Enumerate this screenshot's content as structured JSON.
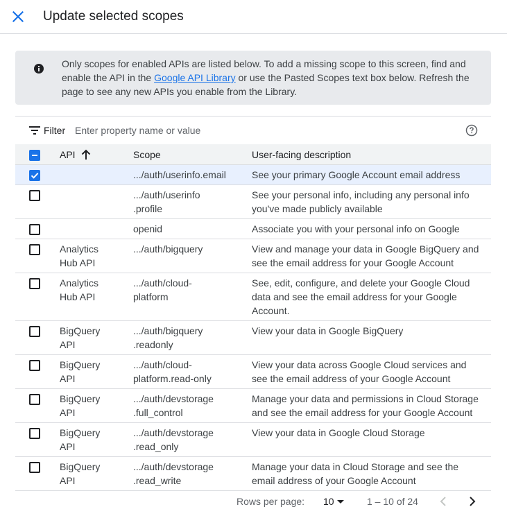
{
  "dialog": {
    "title": "Update selected scopes"
  },
  "info": {
    "text_before": "Only scopes for enabled APIs are listed below. To add a missing scope to this screen, find and enable the API in the ",
    "link": "Google API Library",
    "text_after": " or use the Pasted Scopes text box below. Refresh the page to see any new APIs you enable from the Library."
  },
  "filter": {
    "label": "Filter",
    "placeholder": "Enter property name or value"
  },
  "table": {
    "headers": {
      "api": "API",
      "scope": "Scope",
      "desc": "User-facing description"
    },
    "rows": [
      {
        "checked": true,
        "api_l1": "",
        "api_l2": "",
        "scope_l1": ".../auth/userinfo.email",
        "scope_l2": "",
        "desc_l1": "See your primary Google Account email address",
        "desc_l2": "",
        "desc_l3": ""
      },
      {
        "checked": false,
        "api_l1": "",
        "api_l2": "",
        "scope_l1": ".../auth/userinfo",
        "scope_l2": ".profile",
        "desc_l1": "See your personal info, including any personal info",
        "desc_l2": "you've made publicly available",
        "desc_l3": ""
      },
      {
        "checked": false,
        "api_l1": "",
        "api_l2": "",
        "scope_l1": "openid",
        "scope_l2": "",
        "desc_l1": "Associate you with your personal info on Google",
        "desc_l2": "",
        "desc_l3": ""
      },
      {
        "checked": false,
        "api_l1": "Analytics",
        "api_l2": "Hub API",
        "scope_l1": ".../auth/bigquery",
        "scope_l2": "",
        "desc_l1": "View and manage your data in Google BigQuery and",
        "desc_l2": "see the email address for your Google Account",
        "desc_l3": ""
      },
      {
        "checked": false,
        "api_l1": "Analytics",
        "api_l2": "Hub API",
        "scope_l1": ".../auth/cloud-",
        "scope_l2": "platform",
        "desc_l1": "See, edit, configure, and delete your Google Cloud",
        "desc_l2": "data and see the email address for your Google",
        "desc_l3": "Account."
      },
      {
        "checked": false,
        "api_l1": "BigQuery",
        "api_l2": "API",
        "scope_l1": ".../auth/bigquery",
        "scope_l2": ".readonly",
        "desc_l1": "View your data in Google BigQuery",
        "desc_l2": "",
        "desc_l3": ""
      },
      {
        "checked": false,
        "api_l1": "BigQuery",
        "api_l2": "API",
        "scope_l1": ".../auth/cloud-",
        "scope_l2": "platform.read-only",
        "desc_l1": "View your data across Google Cloud services and",
        "desc_l2": "see the email address of your Google Account",
        "desc_l3": ""
      },
      {
        "checked": false,
        "api_l1": "BigQuery",
        "api_l2": "API",
        "scope_l1": ".../auth/devstorage",
        "scope_l2": ".full_control",
        "desc_l1": "Manage your data and permissions in Cloud Storage",
        "desc_l2": "and see the email address for your Google Account",
        "desc_l3": ""
      },
      {
        "checked": false,
        "api_l1": "BigQuery",
        "api_l2": "API",
        "scope_l1": ".../auth/devstorage",
        "scope_l2": ".read_only",
        "desc_l1": "View your data in Google Cloud Storage",
        "desc_l2": "",
        "desc_l3": ""
      },
      {
        "checked": false,
        "api_l1": "BigQuery",
        "api_l2": "API",
        "scope_l1": ".../auth/devstorage",
        "scope_l2": ".read_write",
        "desc_l1": "Manage your data in Cloud Storage and see the",
        "desc_l2": "email address of your Google Account",
        "desc_l3": ""
      }
    ]
  },
  "pagination": {
    "rows_label": "Rows per page:",
    "rows_value": "10",
    "range": "1 – 10 of 24"
  },
  "colors": {
    "accent": "#1a73e8",
    "selected_row": "#e8f0fe",
    "info_bg": "#e8eaed",
    "header_bg": "#f1f3f4"
  },
  "icons": [
    "close-icon",
    "info-icon",
    "filter-icon",
    "help-icon",
    "sort-arrow-up-icon",
    "checkbox-indeterminate-icon",
    "checkmark-icon",
    "dropdown-arrow-icon",
    "chevron-left-icon",
    "chevron-right-icon"
  ]
}
